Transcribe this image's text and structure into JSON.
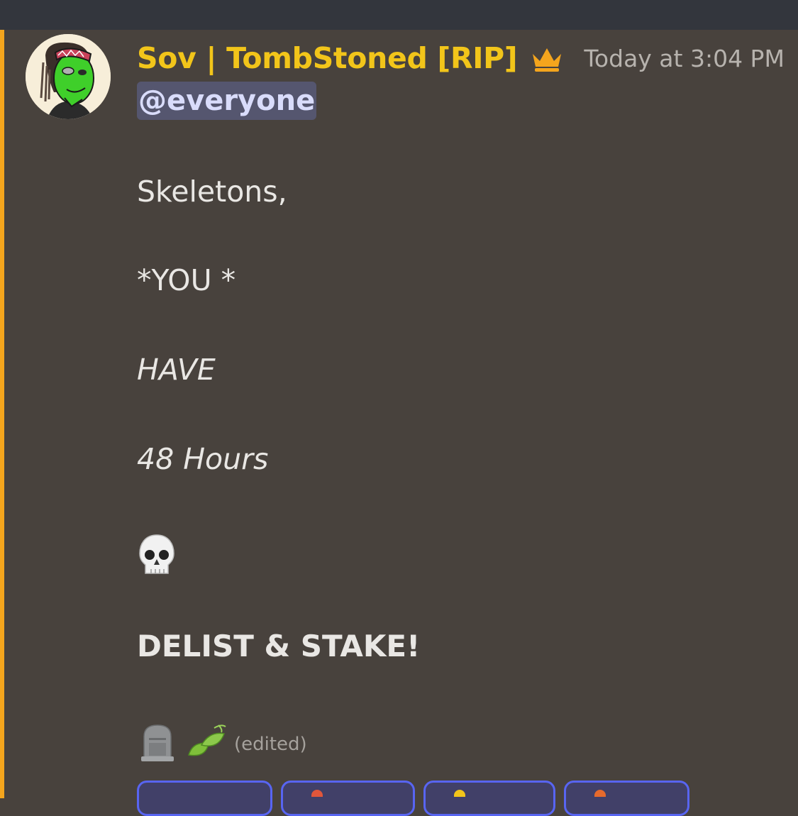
{
  "message": {
    "username": "Sov | TombStoned [RIP]",
    "timestamp": "Today at 3:04 PM",
    "mention": "@everyone",
    "lines": [
      "Skeletons,",
      "*YOU *",
      "HAVE",
      "48 Hours",
      "DELIST & STAKE!"
    ],
    "edited_label": "(edited)"
  },
  "icons": {
    "crown": "crown-icon",
    "skull": "skull-emoji",
    "tombstone": "headstone-emoji",
    "leaves": "leaves-emoji"
  },
  "colors": {
    "background": "#48423d",
    "topbar": "#33363d",
    "accent": "#f4a51d",
    "username": "#f2c51a",
    "mention_bg": "#55566f",
    "mention_text": "#d9dcfb",
    "reaction_border": "#5865f2"
  }
}
